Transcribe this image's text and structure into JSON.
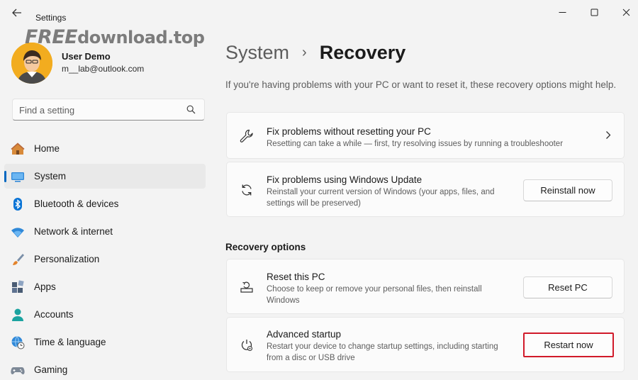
{
  "titlebar": {
    "app_title": "Settings",
    "minimize_icon": "minimize-icon",
    "maximize_icon": "maximize-icon",
    "close_icon": "close-icon"
  },
  "watermark": {
    "part1": "FREE",
    "part2": "download",
    "part3": ".top"
  },
  "profile": {
    "name": "User Demo",
    "email": "m__lab@outlook.com"
  },
  "search": {
    "placeholder": "Find a setting"
  },
  "sidebar": {
    "items": [
      {
        "label": "Home",
        "icon": "home-icon",
        "active": false
      },
      {
        "label": "System",
        "icon": "system-icon",
        "active": true
      },
      {
        "label": "Bluetooth & devices",
        "icon": "bluetooth-icon",
        "active": false
      },
      {
        "label": "Network & internet",
        "icon": "wifi-icon",
        "active": false
      },
      {
        "label": "Personalization",
        "icon": "brush-icon",
        "active": false
      },
      {
        "label": "Apps",
        "icon": "apps-icon",
        "active": false
      },
      {
        "label": "Accounts",
        "icon": "accounts-icon",
        "active": false
      },
      {
        "label": "Time & language",
        "icon": "globe-clock-icon",
        "active": false
      },
      {
        "label": "Gaming",
        "icon": "gamepad-icon",
        "active": false
      }
    ]
  },
  "breadcrumb": {
    "parent": "System",
    "separator": "›",
    "current": "Recovery"
  },
  "intro": "If you're having problems with your PC or want to reset it, these recovery options might help.",
  "cards": {
    "fix_without_reset": {
      "title": "Fix problems without resetting your PC",
      "desc": "Resetting can take a while — first, try resolving issues by running a troubleshooter",
      "icon": "wrench-icon"
    },
    "windows_update": {
      "title": "Fix problems using Windows Update",
      "desc": "Reinstall your current version of Windows (your apps, files, and settings will be preserved)",
      "button": "Reinstall now",
      "icon": "refresh-icon"
    },
    "reset_pc": {
      "title": "Reset this PC",
      "desc": "Choose to keep or remove your personal files, then reinstall Windows",
      "button": "Reset PC",
      "icon": "reset-pc-icon"
    },
    "advanced_startup": {
      "title": "Advanced startup",
      "desc": "Restart your device to change startup settings, including starting from a disc or USB drive",
      "button": "Restart now",
      "icon": "advanced-startup-icon"
    }
  },
  "section_title": "Recovery options",
  "colors": {
    "accent": "#0067c0",
    "highlight": "#d11a2a",
    "background": "#f3f3f3",
    "card": "#fbfbfb"
  }
}
